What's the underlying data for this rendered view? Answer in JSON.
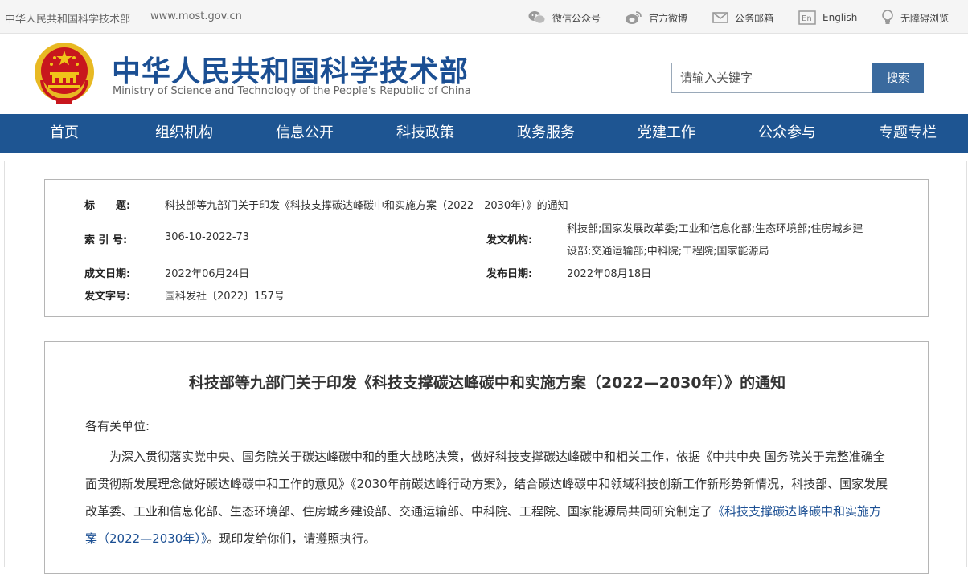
{
  "topbar": {
    "site_name": "中华人民共和国科学技术部",
    "site_url": "www.most.gov.cn",
    "wechat": "微信公众号",
    "weibo": "官方微博",
    "mail": "公务邮箱",
    "english": "English",
    "accessibility": "无障碍浏览"
  },
  "header": {
    "title_cn": "中华人民共和国科学技术部",
    "title_en": "Ministry of Science and Technology of the People's Republic of China",
    "search_placeholder": "请输入关键字",
    "search_button": "搜索"
  },
  "nav": {
    "items": [
      {
        "label": "首页"
      },
      {
        "label": "组织机构"
      },
      {
        "label": "信息公开"
      },
      {
        "label": "科技政策"
      },
      {
        "label": "政务服务"
      },
      {
        "label": "党建工作"
      },
      {
        "label": "公众参与"
      },
      {
        "label": "专题专栏"
      }
    ]
  },
  "meta": {
    "title_label": "标　　题:",
    "title_value": "科技部等九部门关于印发《科技支撑碳达峰碳中和实施方案（2022—2030年）》的通知",
    "index_label": "索 引 号:",
    "index_value": "306-10-2022-73",
    "issuer_label": "发文机构:",
    "issuer_line1": "科技部;国家发展改革委;工业和信息化部;生态环境部;住房城乡建",
    "issuer_line2": "设部;交通运输部;中科院;工程院;国家能源局",
    "date_label": "成文日期:",
    "date_value": "2022年06月24日",
    "publish_label": "发布日期:",
    "publish_value": "2022年08月18日",
    "docnum_label": "发文字号:",
    "docnum_value": "国科发社〔2022〕157号"
  },
  "article": {
    "title": "科技部等九部门关于印发《科技支撑碳达峰碳中和实施方案（2022—2030年）》的通知",
    "salutation": "各有关单位:",
    "para_text": "为深入贯彻落实党中央、国务院关于碳达峰碳中和的重大战略决策，做好科技支撑碳达峰碳中和相关工作，依据《中共中央 国务院关于完整准确全面贯彻新发展理念做好碳达峰碳中和工作的意见》《2030年前碳达峰行动方案》，结合碳达峰碳中和领域科技创新工作新形势新情况，科技部、国家发展改革委、工业和信息化部、生态环境部、住房城乡建设部、交通运输部、中科院、工程院、国家能源局共同研究制定了",
    "para_link": "《科技支撑碳达峰碳中和实施方案（2022—2030年）》",
    "para_end": "。现印发给你们，请遵照执行。"
  },
  "colors": {
    "nav_bg": "#1e5592",
    "brand_blue": "#1b4f93",
    "search_button": "#3a6a9e",
    "emblem_red": "#c8161d",
    "emblem_gold": "#f0c419"
  }
}
